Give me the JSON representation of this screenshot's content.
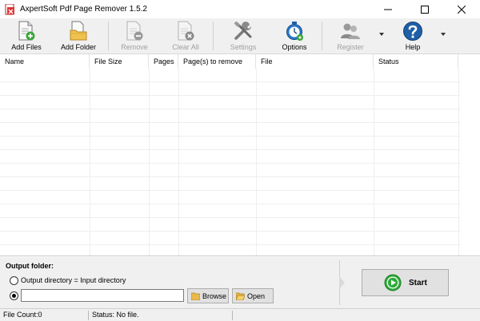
{
  "window": {
    "title": "AxpertSoft Pdf Page Remover 1.5.2",
    "minimize_glyph": "—",
    "maximize_glyph": "☐",
    "close_glyph": "✕"
  },
  "toolbar": {
    "add_files": "Add Files",
    "add_folder": "Add Folder",
    "remove": "Remove",
    "clear_all": "Clear All",
    "settings": "Settings",
    "options": "Options",
    "register": "Register",
    "help": "Help"
  },
  "table": {
    "columns": [
      "Name",
      "File Size",
      "Pages",
      "Page(s) to remove",
      "File",
      "Status"
    ],
    "rows": []
  },
  "output": {
    "label": "Output folder:",
    "option_same_dir": "Output directory = Input directory",
    "selected_option": "custom",
    "directory_value": "",
    "browse": "Browse",
    "open": "Open",
    "start": "Start"
  },
  "status_bar": {
    "file_count": "File Count:0",
    "status": "Status: No file."
  },
  "colors": {
    "toolbar_bg": "#f0f0f0",
    "start_green": "#2eaa3a",
    "help_blue": "#1f5fa8",
    "folder_yellow": "#e9b94a"
  }
}
